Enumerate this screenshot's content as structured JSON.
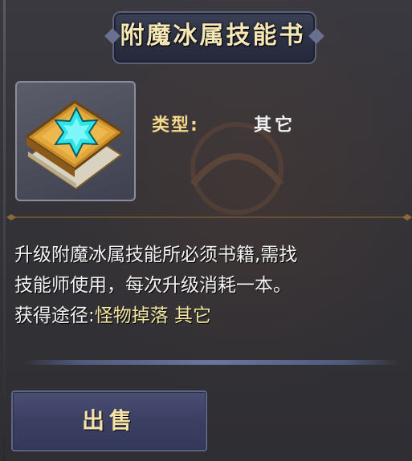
{
  "item": {
    "title": "附魔冰属技能书",
    "icon": "skill-book-ice-star-icon",
    "type_label": "类型:",
    "type_value": "其它"
  },
  "description": {
    "line1": "升级附魔冰属技能所必须书籍,需找",
    "line2": "技能师使用，每次升级消耗一本。",
    "acquire_label": "获得途径:",
    "acquire_value": "怪物掉落 其它"
  },
  "actions": {
    "sell_label": "出售"
  },
  "colors": {
    "title": "#f5e7b6",
    "label_gold": "#f2d88a",
    "acquire_value": "#f3e6a2",
    "gem_cyan": "#2fe6e6"
  }
}
